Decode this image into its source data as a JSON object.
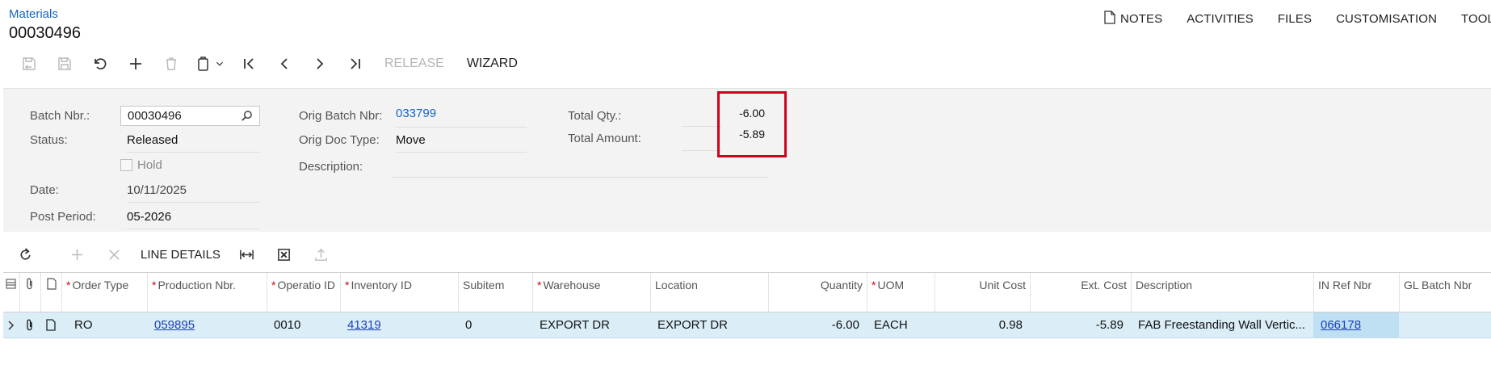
{
  "breadcrumb": "Materials",
  "page_title": "00030496",
  "top_menu": {
    "notes": "NOTES",
    "activities": "ACTIVITIES",
    "files": "FILES",
    "customisation": "CUSTOMISATION",
    "tools": "TOOLS"
  },
  "toolbar": {
    "release": "RELEASE",
    "wizard": "WIZARD"
  },
  "form": {
    "batch_nbr_label": "Batch Nbr.:",
    "batch_nbr_value": "00030496",
    "status_label": "Status:",
    "status_value": "Released",
    "hold_label": "Hold",
    "date_label": "Date:",
    "date_value": "10/11/2025",
    "post_period_label": "Post Period:",
    "post_period_value": "05-2026",
    "orig_batch_label": "Orig Batch Nbr:",
    "orig_batch_value": "033799",
    "orig_doc_type_label": "Orig Doc Type:",
    "orig_doc_type_value": "Move",
    "description_label": "Description:",
    "description_value": "",
    "total_qty_label": "Total Qty.:",
    "total_qty_value": "-6.00",
    "total_amount_label": "Total Amount:",
    "total_amount_value": "-5.89"
  },
  "grid_toolbar": {
    "line_details": "LINE DETAILS"
  },
  "grid": {
    "headers": {
      "order_type": "Order Type",
      "production_nbr": "Production Nbr.",
      "operation_id": "Operatio ID",
      "inventory_id": "Inventory ID",
      "subitem": "Subitem",
      "warehouse": "Warehouse",
      "location": "Location",
      "quantity": "Quantity",
      "uom": "UOM",
      "unit_cost": "Unit Cost",
      "ext_cost": "Ext. Cost",
      "description": "Description",
      "in_ref_nbr": "IN Ref Nbr",
      "gl_batch_nbr": "GL Batch Nbr"
    },
    "row": {
      "order_type": "RO",
      "production_nbr": "059895",
      "operation_id": "0010",
      "inventory_id": "41319",
      "subitem": "0",
      "warehouse": "EXPORT DR",
      "location": "EXPORT DR",
      "quantity": "-6.00",
      "uom": "EACH",
      "unit_cost": "0.98",
      "ext_cost": "-5.89",
      "description": "FAB Freestanding Wall Vertic...",
      "in_ref_nbr": "066178",
      "gl_batch_nbr": ""
    }
  },
  "colors": {
    "link": "#1565c0",
    "highlight_box": "#d0021b",
    "row_selected": "#dbeef8",
    "form_bg": "#f3f3f3"
  }
}
